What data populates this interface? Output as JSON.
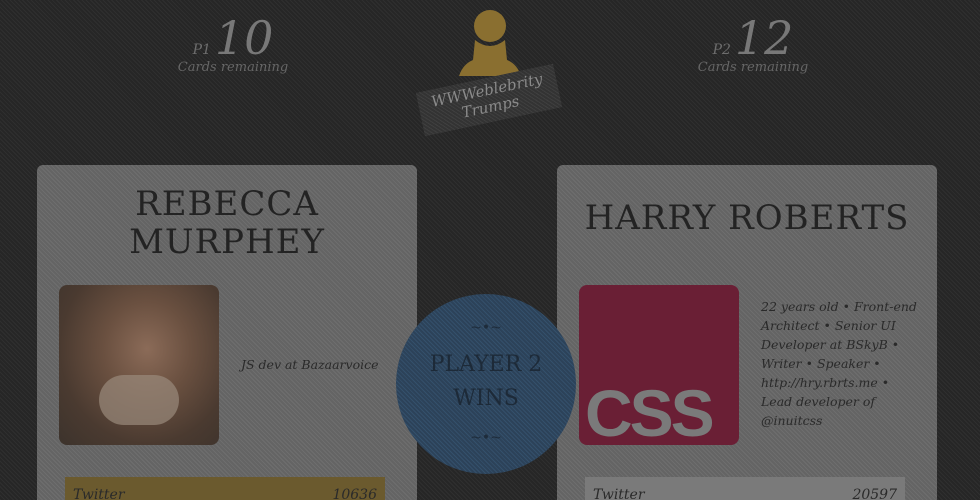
{
  "players": {
    "p1": {
      "label": "P1",
      "count": "10",
      "sub": "Cards remaining"
    },
    "p2": {
      "label": "P2",
      "count": "12",
      "sub": "Cards remaining"
    }
  },
  "logo": {
    "line1": "WWWeblebrity",
    "line2": "Trumps",
    "icon": "person-silhouette-icon"
  },
  "cards": {
    "left": {
      "name": "REBECCA MURPHEY",
      "bio": "JS dev at Bazaarvoice",
      "stat_label": "Twitter",
      "stat_value": "10636"
    },
    "right": {
      "name": "HARRY ROBERTS",
      "bio": "22 years old • Front-end Architect • Senior UI Developer at BSkyB • Writer • Speaker • http://hry.rbrts.me • Lead developer of @inuitcss",
      "image_text": "CSS",
      "stat_label": "Twitter",
      "stat_value": "20597"
    }
  },
  "result": {
    "ornament": "~•~",
    "text": "PLAYER 2 WINS"
  },
  "colors": {
    "accent_gold": "#b8963f",
    "result_blue": "#4a7aa8",
    "css_red": "#c8335f"
  }
}
